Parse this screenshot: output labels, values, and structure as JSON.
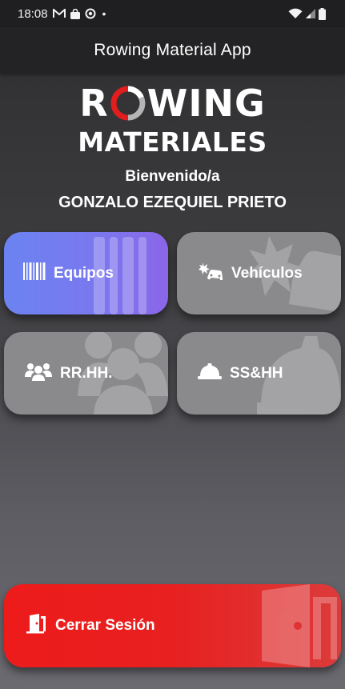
{
  "status_bar": {
    "time": "18:08",
    "left_icons": [
      "gmail-icon",
      "bag-icon",
      "record-icon",
      "dot-icon"
    ],
    "right_icons": [
      "wifi-icon",
      "signal-icon",
      "battery-icon"
    ],
    "dot": "•"
  },
  "app_bar": {
    "title": "Rowing Material App"
  },
  "logo": {
    "top_left": "R",
    "top_right": "WING",
    "bottom": "MATERIALES",
    "ring_colors": [
      "#ffffff",
      "#e21d1d",
      "#b5b5b5"
    ]
  },
  "welcome": {
    "greeting": "Bienvenido/a",
    "user": "GONZALO EZEQUIEL PRIETO"
  },
  "tiles": [
    {
      "label": "Equipos",
      "icon": "barcode-icon"
    },
    {
      "label": "Vehículos",
      "icon": "car-crash-icon"
    },
    {
      "label": "RR.HH.",
      "icon": "people-group-icon"
    },
    {
      "label": "SS&HH",
      "icon": "hard-hat-icon"
    }
  ],
  "logout": {
    "label": "Cerrar Sesión",
    "icon": "door-exit-icon"
  },
  "colors": {
    "equipos_gradient": [
      "#6b83f0",
      "#8a66e8"
    ],
    "logout_gradient": [
      "#ee1b1b",
      "#dc3b3b"
    ],
    "tile_gray": "#8a8a8d"
  }
}
